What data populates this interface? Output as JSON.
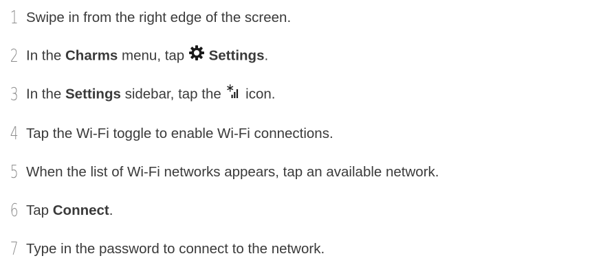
{
  "steps": [
    {
      "number": "1",
      "text": "Swipe in from the right edge of the screen."
    },
    {
      "number": "2",
      "pre": "In the ",
      "bold1": "Charms",
      "mid": " menu, tap ",
      "icon": "gear-icon",
      "bold2": "Settings",
      "post": "."
    },
    {
      "number": "3",
      "pre": "In the ",
      "bold1": "Settings",
      "mid": " sidebar, tap the ",
      "icon": "wireless-signal-icon",
      "post": " icon."
    },
    {
      "number": "4",
      "text": "Tap the Wi-Fi toggle to enable Wi-Fi connections."
    },
    {
      "number": "5",
      "text": "When the list of Wi-Fi networks appears, tap an available network."
    },
    {
      "number": "6",
      "pre": "Tap ",
      "bold1": "Connect",
      "post": "."
    },
    {
      "number": "7",
      "text": "Type in the password to connect to the network."
    }
  ]
}
